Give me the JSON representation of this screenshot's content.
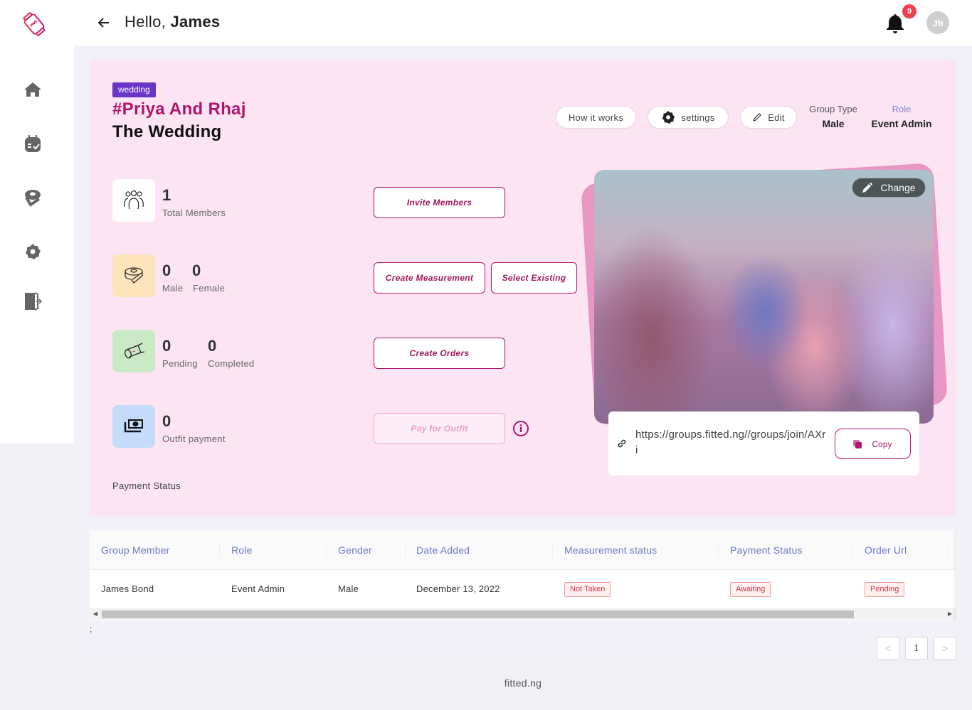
{
  "header": {
    "greeting_prefix": "Hello,",
    "user_first_name": "James",
    "notification_count": "9",
    "avatar_initials": "Jb"
  },
  "sidebar": {
    "items": [
      {
        "icon": "home-icon",
        "label": "Home"
      },
      {
        "icon": "calendar-check-icon",
        "label": "Events"
      },
      {
        "icon": "measuring-tape-icon",
        "label": "Measurements"
      },
      {
        "icon": "gear-icon",
        "label": "Settings"
      },
      {
        "icon": "logout-icon",
        "label": "Logout"
      }
    ]
  },
  "event": {
    "tag": "wedding",
    "name": "#Priya And Rhaj",
    "subtitle": "The Wedding",
    "how_it_works_label": "How it works",
    "settings_label": "settings",
    "edit_label": "Edit",
    "group_type_label": "Group Type",
    "group_type_value": "Male",
    "role_label": "Role",
    "role_value": "Event Admin"
  },
  "stats": {
    "members": {
      "value": "1",
      "label": "Total Members"
    },
    "measurements": {
      "male_value": "0",
      "male_label": "Male",
      "female_value": "0",
      "female_label": "Female"
    },
    "orders": {
      "pending_value": "0",
      "pending_label": "Pending",
      "completed_value": "0",
      "completed_label": "Completed"
    },
    "payment": {
      "value": "0",
      "label": "Outfit payment"
    },
    "payment_status_label": "Payment Status"
  },
  "actions": {
    "invite_members": "Invite Members",
    "create_measurement": "Create Measurement",
    "select_existing": "Select Existing",
    "create_orders": "Create Orders",
    "pay_for_outfit": "Pay for Outfit"
  },
  "photo": {
    "change_label": "Change",
    "alt": "Wedding group photo"
  },
  "invite_link": {
    "url": "https://groups.fitted.ng//groups/join/AXri",
    "copy_label": "Copy"
  },
  "table": {
    "columns": [
      "Group Member",
      "Role",
      "Gender",
      "Date Added",
      "Measurement status",
      "Payment Status",
      "Order Url"
    ],
    "rows": [
      {
        "member": "James Bond",
        "role": "Event Admin",
        "gender": "Male",
        "date_added": "December 13, 2022",
        "measurement_status": "Not Taken",
        "payment_status": "Awaiting",
        "order_url": "Pending"
      }
    ]
  },
  "misc": {
    "stray_text": ";"
  },
  "pagination": {
    "current_page": "1",
    "prev": "<",
    "next": ">"
  },
  "footer": {
    "text": "fitted.ng"
  },
  "colors": {
    "brand": "#b0156e",
    "tag_bg": "#6b34c9",
    "hero_bg": "#fce4f2",
    "header_text": "#6f78c4",
    "status_red": "#d9364a"
  }
}
